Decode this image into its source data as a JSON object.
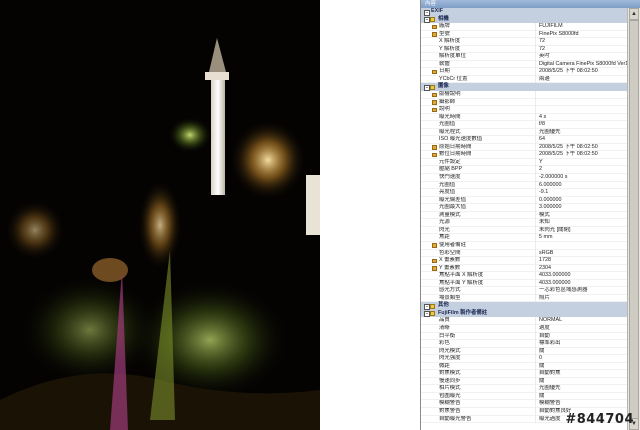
{
  "panel": {
    "title": "內容"
  },
  "watermark": "#844704",
  "groups": [
    {
      "title": "EXIF",
      "top": true,
      "rows": []
    },
    {
      "title": "相機",
      "rows": [
        {
          "label": "廠牌",
          "value": "FUJIFILM",
          "pen": true
        },
        {
          "label": "型號",
          "value": "FinePix S8000fd",
          "pen": true
        },
        {
          "label": "X 解析度",
          "value": "72"
        },
        {
          "label": "Y 解析度",
          "value": "72"
        },
        {
          "label": "解析度單位",
          "value": "英吋"
        },
        {
          "label": "軟體",
          "value": "Digital Camera FinePix S8000fd Ver1.00"
        },
        {
          "label": "日期",
          "value": "2008/5/25 下午 08:02:50",
          "pen": true
        },
        {
          "label": "YCbCr 位置",
          "value": "兩邊"
        }
      ]
    },
    {
      "title": "圖像",
      "rows": [
        {
          "label": "版權說明",
          "value": "",
          "pen": true
        },
        {
          "label": "攝影師",
          "value": "",
          "pen": true
        },
        {
          "label": "說明",
          "value": "",
          "pen": true
        },
        {
          "label": "曝光時間",
          "value": "4 s"
        },
        {
          "label": "光圈值",
          "value": "f/8"
        },
        {
          "label": "曝光程式",
          "value": "光圈優先"
        },
        {
          "label": "ISO 曝光速度數值",
          "value": "64"
        },
        {
          "label": "原始日期時間",
          "value": "2008/5/25 下午 08:02:50",
          "pen": true
        },
        {
          "label": "數位日期時間",
          "value": "2008/5/25 下午 08:02:50",
          "pen": true
        },
        {
          "label": "元件設定",
          "value": "Y"
        },
        {
          "label": "壓縮 BPP",
          "value": "2"
        },
        {
          "label": "快門速度",
          "value": "-2.000000 s"
        },
        {
          "label": "光圈值",
          "value": "6.000000"
        },
        {
          "label": "亮度值",
          "value": "-9.1"
        },
        {
          "label": "曝光偏差值",
          "value": "0.000000"
        },
        {
          "label": "光圈最大值",
          "value": "3.000000"
        },
        {
          "label": "測量模式",
          "value": "模式"
        },
        {
          "label": "光源",
          "value": "未知"
        },
        {
          "label": "閃光",
          "value": "未閃光 [關閉]"
        },
        {
          "label": "焦距",
          "value": "5 mm"
        },
        {
          "label": "使用者備註",
          "value": "",
          "pen": true
        },
        {
          "label": "色彩空間",
          "value": "sRGB"
        },
        {
          "label": "X 畫素數",
          "value": "1728",
          "pen": true
        },
        {
          "label": "Y 畫素數",
          "value": "2304",
          "pen": true
        },
        {
          "label": "焦點平面 X 解析度",
          "value": "4033.000000"
        },
        {
          "label": "焦點平面 Y 解析度",
          "value": "4033.000000"
        },
        {
          "label": "感光方式",
          "value": "一芯彩色區域感測器"
        },
        {
          "label": "場景類型",
          "value": "照片"
        }
      ]
    },
    {
      "title": "其他",
      "rows": []
    },
    {
      "title": "FujiFilm 製作者備註",
      "rows": [
        {
          "label": "品質",
          "value": "NORMAL"
        },
        {
          "label": "清晰",
          "value": "適度"
        },
        {
          "label": "白平衡",
          "value": "自動"
        },
        {
          "label": "彩色",
          "value": "標準彩出"
        },
        {
          "label": "閃光模式",
          "value": "關"
        },
        {
          "label": "閃光強度",
          "value": "0"
        },
        {
          "label": "微距",
          "value": "關"
        },
        {
          "label": "對焦模式",
          "value": "自動對焦"
        },
        {
          "label": "慢速同步",
          "value": "關"
        },
        {
          "label": "相片模式",
          "value": "光圈優先"
        },
        {
          "label": "包圍曝光",
          "value": "關"
        },
        {
          "label": "模糊警告",
          "value": "模糊警告"
        },
        {
          "label": "對焦警告",
          "value": "自動對焦良好"
        },
        {
          "label": "自動曝光警告",
          "value": "曝光過度"
        }
      ]
    }
  ]
}
